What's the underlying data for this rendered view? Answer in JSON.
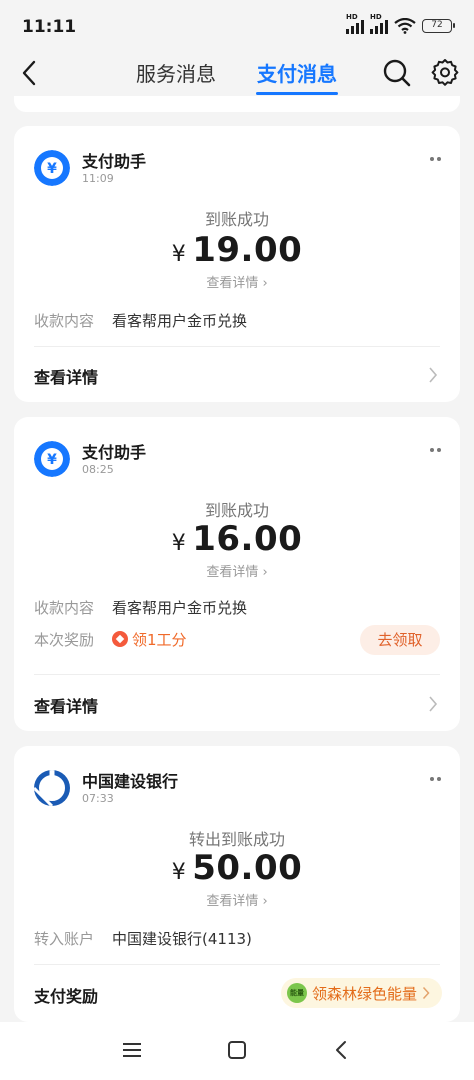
{
  "status_bar": {
    "time": "11:11",
    "battery": "72"
  },
  "header": {
    "tab_service": "服务消息",
    "tab_pay": "支付消息"
  },
  "cards": [
    {
      "sender": "支付助手",
      "time": "11:09",
      "status": "到账成功",
      "currency": "¥",
      "amount": "19.00",
      "view_detail": "查看详情",
      "row1_key": "收款内容",
      "row1_value": "看客帮用户金币兑换",
      "footer": "查看详情"
    },
    {
      "sender": "支付助手",
      "time": "08:25",
      "status": "到账成功",
      "currency": "¥",
      "amount": "16.00",
      "view_detail": "查看详情",
      "row1_key": "收款内容",
      "row1_value": "看客帮用户金币兑换",
      "row2_key": "本次奖励",
      "row2_value": "领1工分",
      "claim_button": "去领取",
      "footer": "查看详情"
    },
    {
      "sender": "中国建设银行",
      "time": "07:33",
      "status": "转出到账成功",
      "currency": "¥",
      "amount": "50.00",
      "view_detail": "查看详情",
      "row1_key": "转入账户",
      "row1_value": "中国建设银行(4113)",
      "footer": "支付奖励",
      "energy_badge": "能量",
      "energy_label": "领森林绿色能量"
    }
  ],
  "colors": {
    "accent": "#1677ff",
    "alipay_blue": "#1677ff",
    "ccb_blue": "#1a5bb5",
    "reward_orange": "#f06a2a"
  },
  "icons": [
    "back-arrow-icon",
    "search-icon",
    "gear-icon",
    "more-dots-icon",
    "chevron-right-icon",
    "yen-coin-icon",
    "ccb-logo-icon",
    "leaf-energy-icon",
    "menu-icon",
    "home-square-icon",
    "back-triangle-icon"
  ]
}
